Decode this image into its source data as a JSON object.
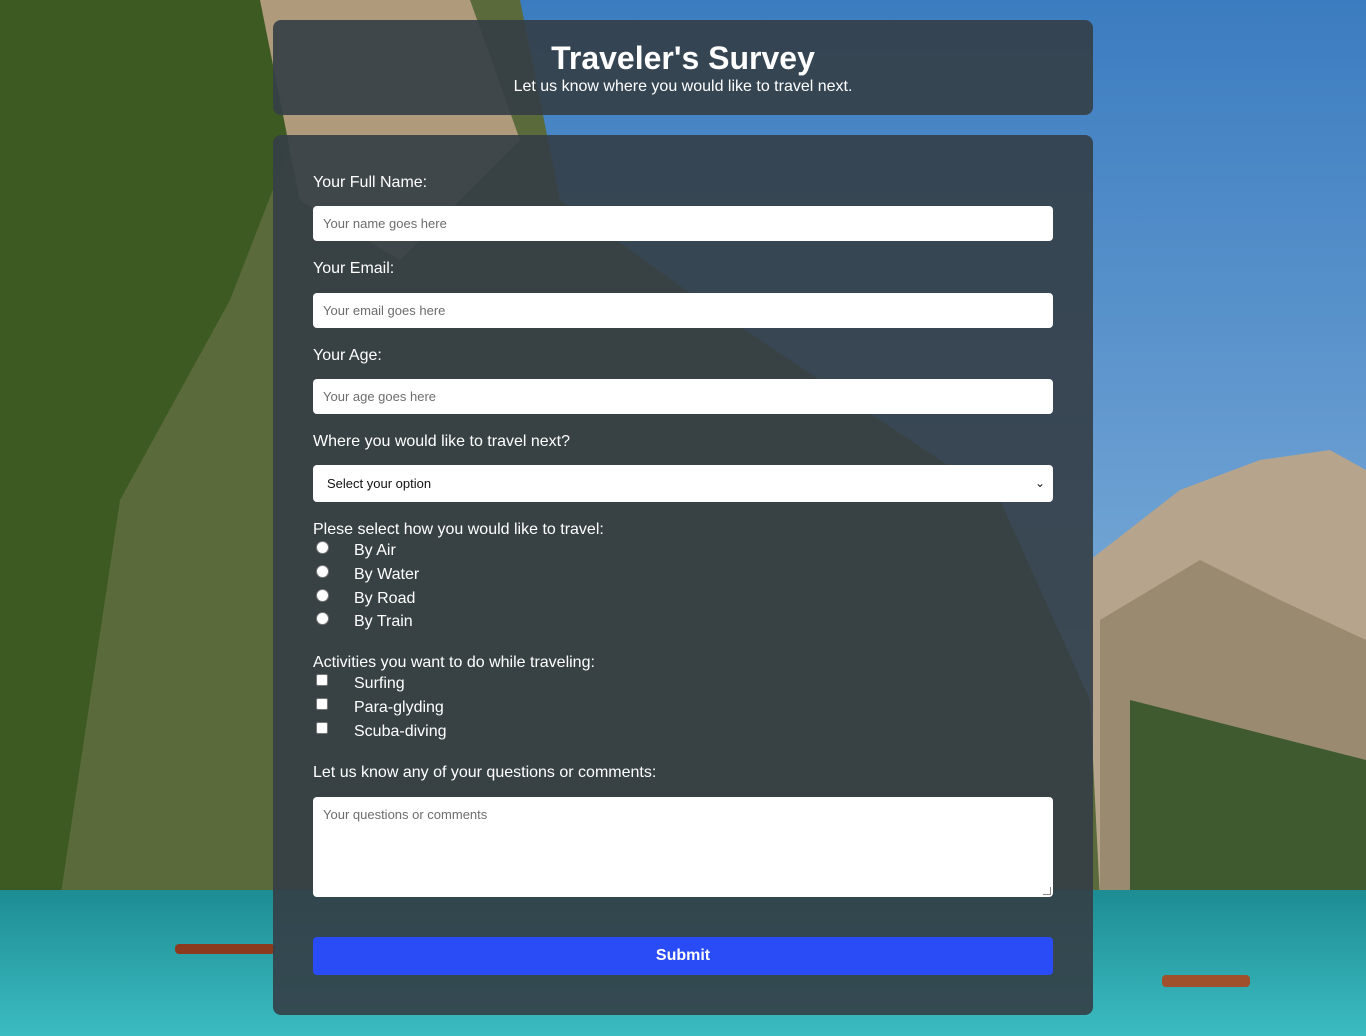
{
  "header": {
    "title": "Traveler's Survey",
    "description": "Let us know where you would like to travel next."
  },
  "form": {
    "name_label": "Your Full Name:",
    "name_placeholder": "Your name goes here",
    "email_label": "Your Email:",
    "email_placeholder": "Your email goes here",
    "age_label": "Your Age:",
    "age_placeholder": "Your age goes here",
    "destination_label": "Where you would like to travel next?",
    "destination_selected": "Select your option",
    "travel_label": "Plese select how you would like to travel:",
    "travel_options": [
      "By Air",
      "By Water",
      "By Road",
      "By Train"
    ],
    "activities_label": "Activities you want to do while traveling:",
    "activity_options": [
      "Surfing",
      "Para-glyding",
      "Scuba-diving"
    ],
    "comments_label": "Let us know any of your questions or comments:",
    "comments_placeholder": "Your questions or comments",
    "submit_label": "Submit"
  },
  "colors": {
    "panel": "#343e46",
    "submit": "#2a4cf7"
  }
}
